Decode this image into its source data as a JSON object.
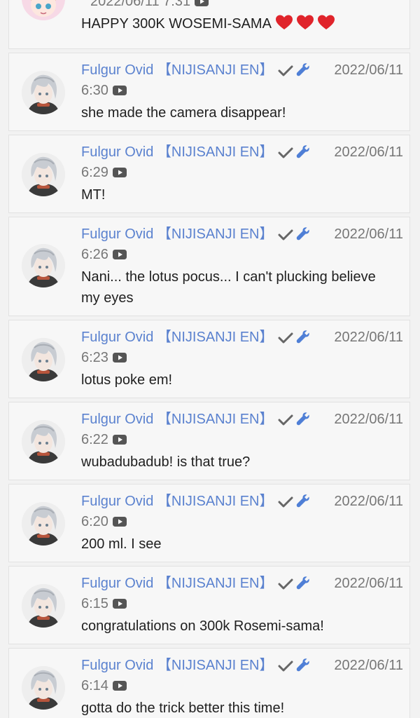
{
  "feed": {
    "top_comment": {
      "timestamp": "2022/06/11 7:31",
      "video_icon": "youtube-icon",
      "text": "HAPPY 300K WOSEMI-SAMA",
      "emojis": [
        "heart-emoji",
        "heart-emoji",
        "heart-emoji"
      ],
      "heart_color": "#e0242b"
    },
    "comments": [
      {
        "author": "Fulgur Ovid 【NIJISANJI EN】",
        "date": "2022/06/11",
        "time": "6:30",
        "text": "she made the camera disappear!"
      },
      {
        "author": "Fulgur Ovid 【NIJISANJI EN】",
        "date": "2022/06/11",
        "time": "6:29",
        "text": "MT!"
      },
      {
        "author": "Fulgur Ovid 【NIJISANJI EN】",
        "date": "2022/06/11",
        "time": "6:26",
        "text": "Nani... the lotus pocus... I can't plucking believe my eyes"
      },
      {
        "author": "Fulgur Ovid 【NIJISANJI EN】",
        "date": "2022/06/11",
        "time": "6:23",
        "text": "lotus poke em!"
      },
      {
        "author": "Fulgur Ovid 【NIJISANJI EN】",
        "date": "2022/06/11",
        "time": "6:22",
        "text": "wubadubadub! is that true?"
      },
      {
        "author": "Fulgur Ovid 【NIJISANJI EN】",
        "date": "2022/06/11",
        "time": "6:20",
        "text": "200 ml. I see"
      },
      {
        "author": "Fulgur Ovid 【NIJISANJI EN】",
        "date": "2022/06/11",
        "time": "6:15",
        "text": "congratulations on 300k Rosemi-sama!"
      },
      {
        "author": "Fulgur Ovid 【NIJISANJI EN】",
        "date": "2022/06/11",
        "time": "6:14",
        "text": "gotta do the trick better this time!"
      }
    ],
    "badge_icons": [
      "verified-check-icon",
      "moderator-wrench-icon"
    ],
    "video_icon": "youtube-icon",
    "colors": {
      "author": "#5b82cf",
      "badge": "#666666",
      "timestamp": "#777777",
      "message": "#1f1f1f",
      "card_background": "#f7f7f7"
    }
  }
}
